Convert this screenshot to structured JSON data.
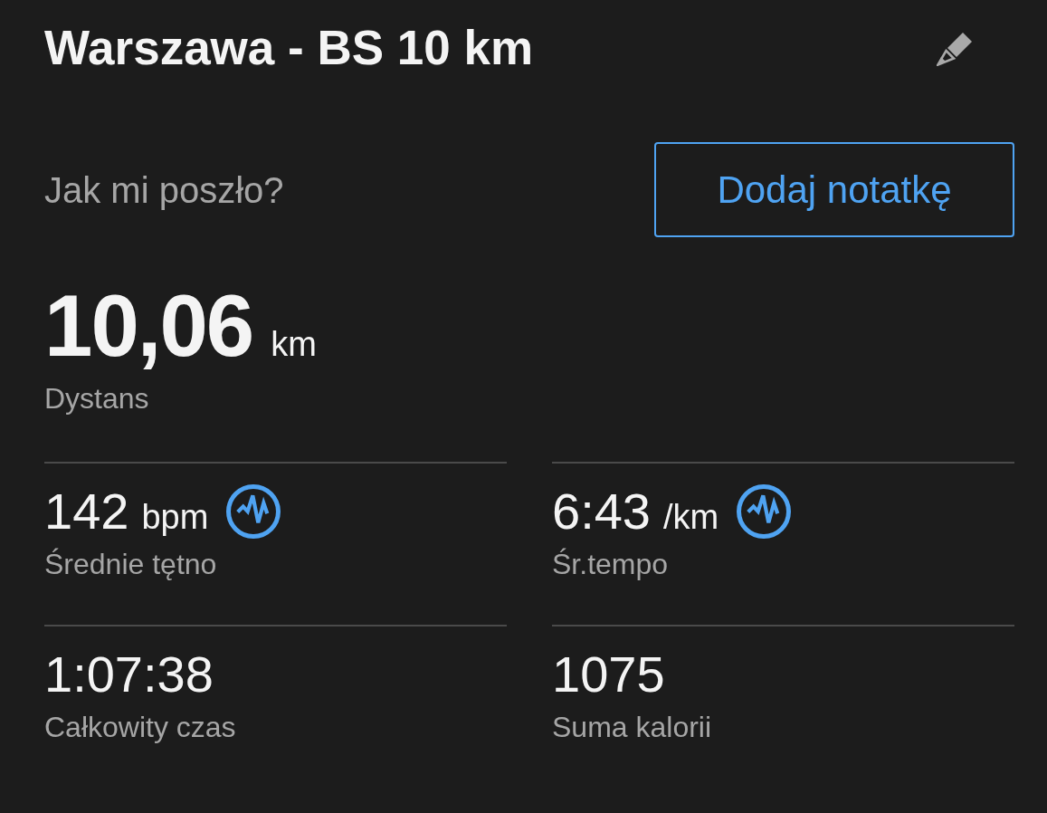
{
  "title": "Warszawa - BS 10 km",
  "feedback": {
    "prompt": "Jak mi poszło?",
    "button": "Dodaj notatkę"
  },
  "distance": {
    "value": "10,06",
    "unit": "km",
    "label": "Dystans"
  },
  "stats": [
    {
      "kind": "with_icon",
      "value": "142",
      "unit": "bpm",
      "label": "Średnie tętno"
    },
    {
      "kind": "with_icon",
      "value": "6:43",
      "unit": "/km",
      "label": "Śr.tempo"
    },
    {
      "kind": "plain",
      "value": "1:07:38",
      "label": "Całkowity czas"
    },
    {
      "kind": "plain",
      "value": "1075",
      "label": "Suma kalorii"
    }
  ]
}
